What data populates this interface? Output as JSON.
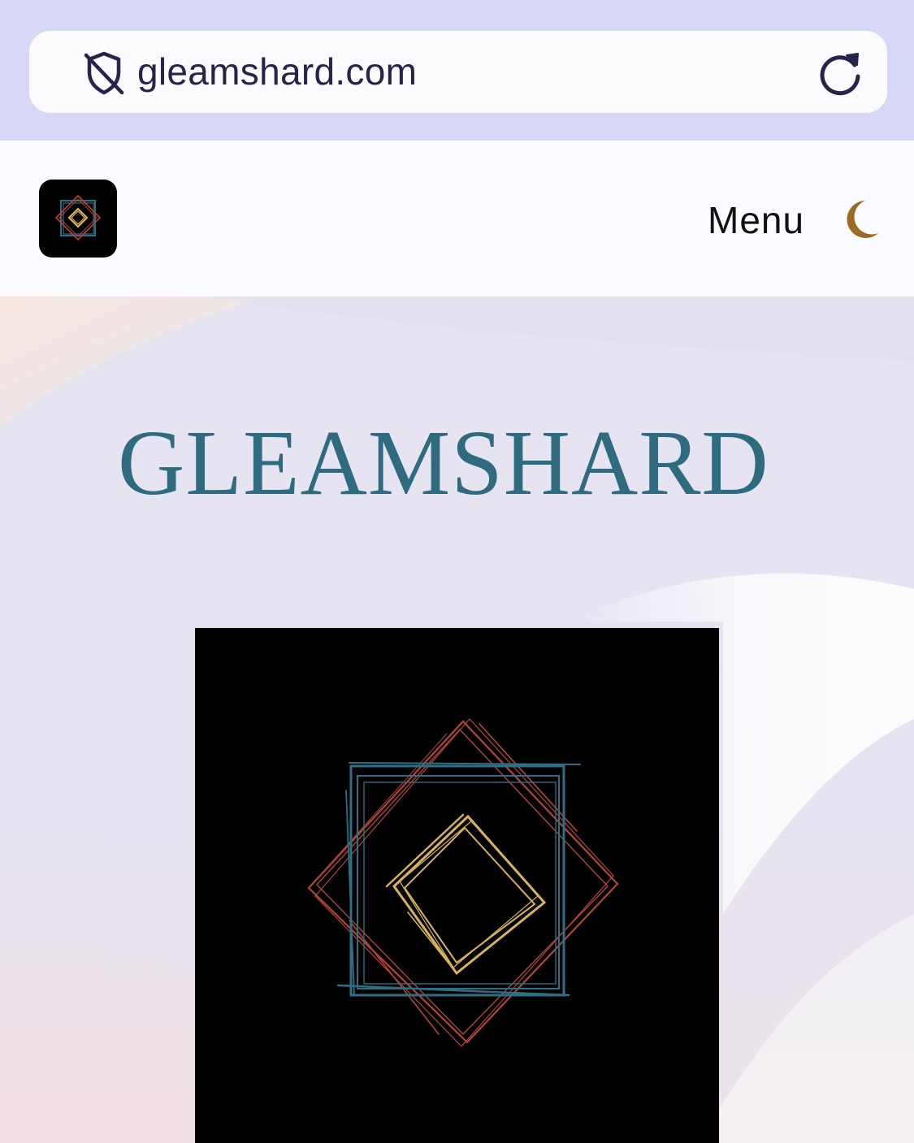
{
  "browser": {
    "url": "gleamshard.com"
  },
  "header": {
    "menu_label": "Menu"
  },
  "hero": {
    "title": "GLEAMSHARD"
  },
  "icons": {
    "shield": "shield-slash-icon",
    "reload": "reload-icon",
    "theme": "moon-icon"
  },
  "colors": {
    "browser_bar": "#d7d8f5",
    "title": "#2e6b7e",
    "moon": "#9a6b22",
    "logo_gold": "#d9b25a",
    "logo_teal": "#2f6f86",
    "logo_red": "#b5433a"
  }
}
